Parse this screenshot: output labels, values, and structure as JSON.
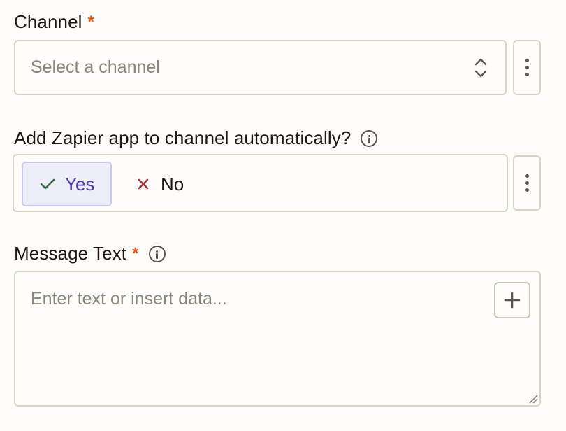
{
  "fields": {
    "channel": {
      "label": "Channel",
      "required_mark": "*",
      "placeholder": "Select a channel"
    },
    "add_app": {
      "label": "Add Zapier app to channel automatically?",
      "yes_label": "Yes",
      "no_label": "No",
      "selected": "Yes"
    },
    "message": {
      "label": "Message Text",
      "required_mark": "*",
      "placeholder": "Enter text or insert data..."
    }
  },
  "colors": {
    "required": "#e0531b",
    "selected_bg": "#eeeefb",
    "selected_text": "#4b3fa6",
    "check": "#2f6b3a",
    "cross": "#a3303a"
  },
  "icons": {
    "info": "info-icon",
    "select": "chevron-up-down-icon",
    "more": "more-vertical-icon",
    "check": "check-icon",
    "cross": "close-icon",
    "plus": "plus-icon",
    "resize": "resize-handle-icon"
  }
}
